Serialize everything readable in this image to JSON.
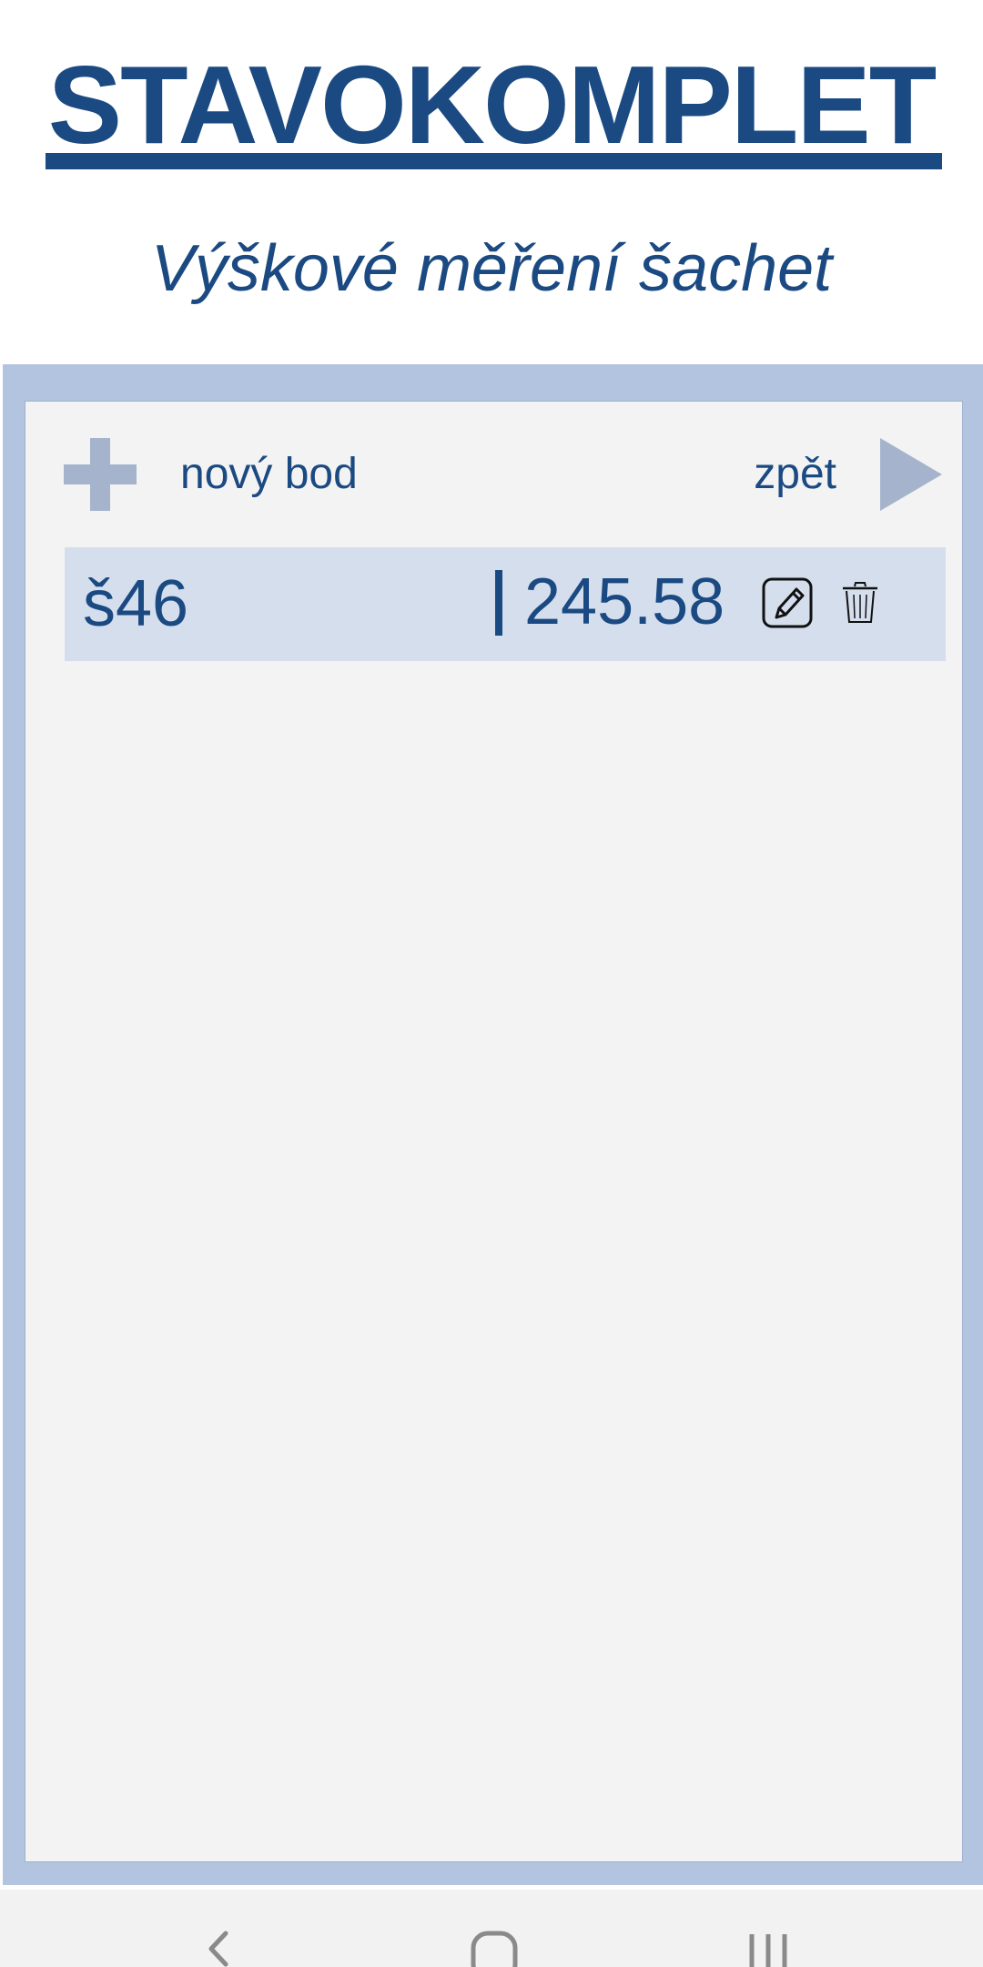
{
  "app": {
    "logo_text": "STAVOKOMPLET",
    "subtitle": "Výškové měření šachet"
  },
  "toolbar": {
    "add_label": "nový bod",
    "add_icon": "plus-icon",
    "back_label": "zpět",
    "back_icon": "play-icon"
  },
  "points": [
    {
      "name": "š46",
      "value": "245.58",
      "edit_icon": "edit-icon",
      "delete_icon": "trash-icon"
    }
  ],
  "navbar": {
    "buttons": [
      "back-icon",
      "home-icon",
      "recents-icon"
    ]
  },
  "colors": {
    "brand": "#1b4a82",
    "panel_outer": "#b3c4e0",
    "panel_inner": "#f3f3f3",
    "row_background": "#d4deed",
    "icon_accent": "#a5b4cc"
  }
}
